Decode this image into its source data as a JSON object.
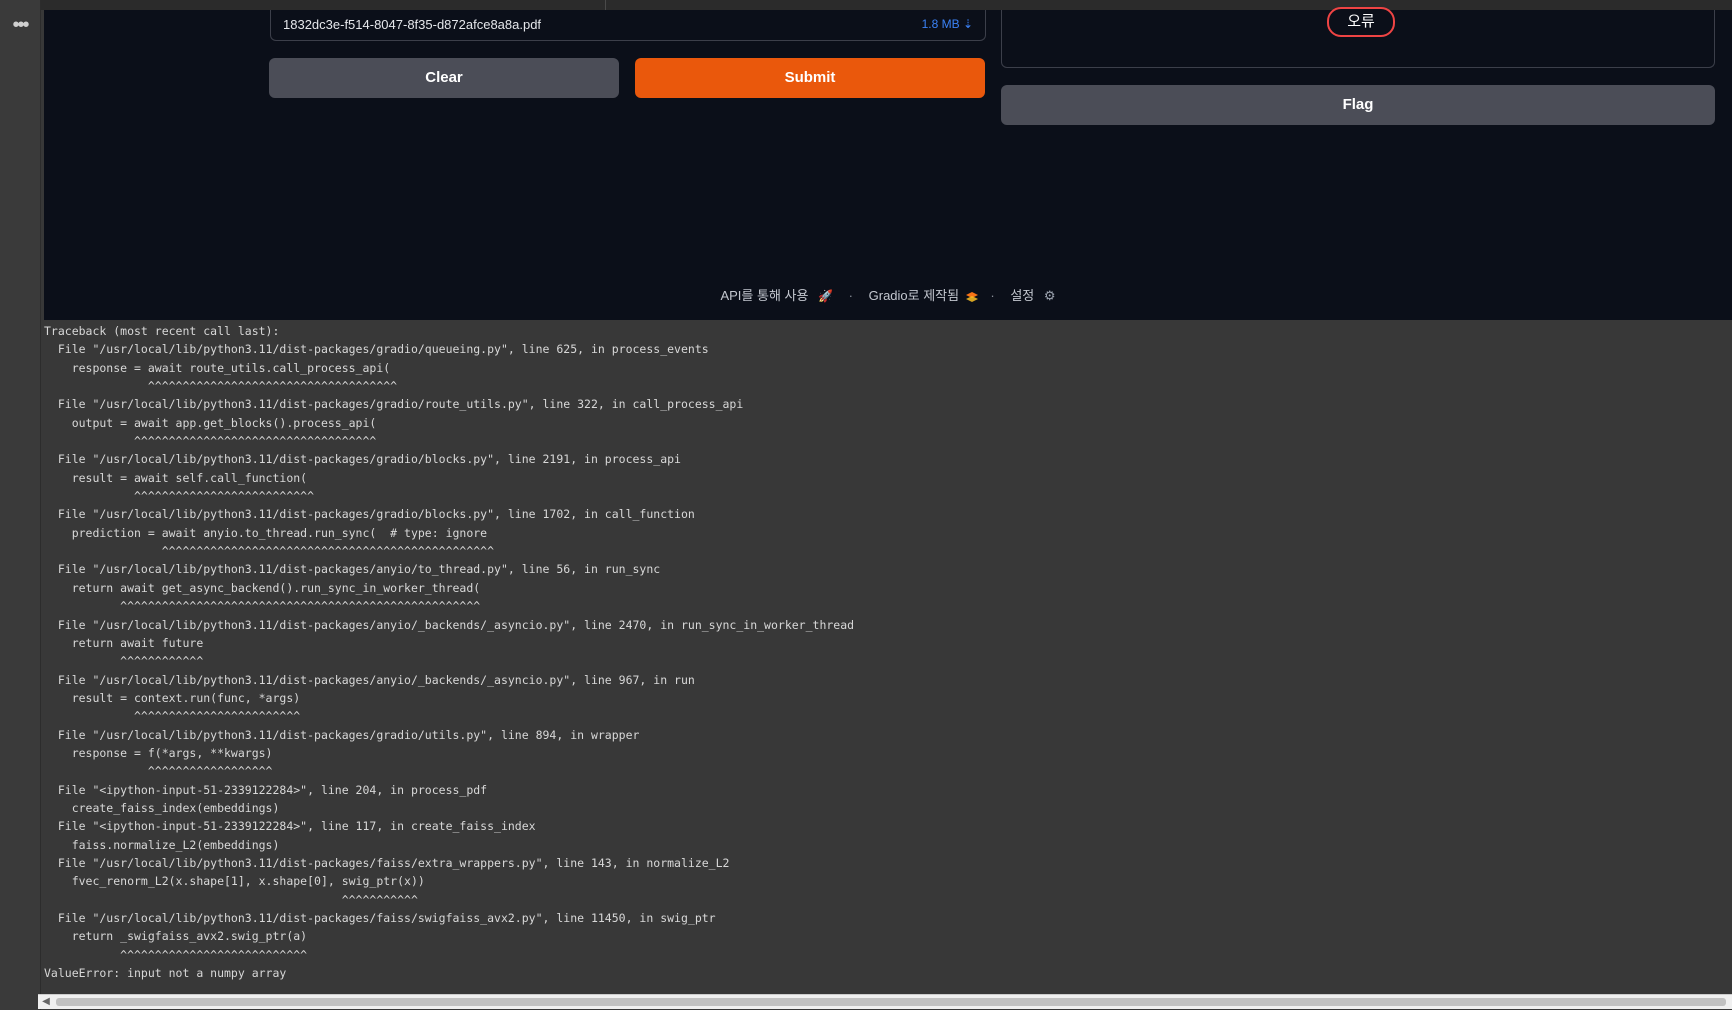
{
  "more_menu": {
    "label": "•••"
  },
  "input": {
    "file_name": "1832dc3e-f514-8047-8f35-d872afce8a8a.pdf",
    "file_size": "1.8 MB ⇣"
  },
  "buttons": {
    "clear": "Clear",
    "submit": "Submit",
    "flag": "Flag"
  },
  "output": {
    "status_badge": "오류"
  },
  "footer": {
    "api": "API를 통해 사용",
    "api_icon": "🚀",
    "gradio": "Gradio로 제작됨",
    "settings": "설정",
    "settings_icon": "⚙",
    "separator": "·"
  },
  "traceback": {
    "lines": [
      "Traceback (most recent call last):",
      "  File \"/usr/local/lib/python3.11/dist-packages/gradio/queueing.py\", line 625, in process_events",
      "    response = await route_utils.call_process_api(",
      "               ^^^^^^^^^^^^^^^^^^^^^^^^^^^^^^^^^^^^",
      "  File \"/usr/local/lib/python3.11/dist-packages/gradio/route_utils.py\", line 322, in call_process_api",
      "    output = await app.get_blocks().process_api(",
      "             ^^^^^^^^^^^^^^^^^^^^^^^^^^^^^^^^^^^",
      "  File \"/usr/local/lib/python3.11/dist-packages/gradio/blocks.py\", line 2191, in process_api",
      "    result = await self.call_function(",
      "             ^^^^^^^^^^^^^^^^^^^^^^^^^^",
      "  File \"/usr/local/lib/python3.11/dist-packages/gradio/blocks.py\", line 1702, in call_function",
      "    prediction = await anyio.to_thread.run_sync(  # type: ignore",
      "                 ^^^^^^^^^^^^^^^^^^^^^^^^^^^^^^^^^^^^^^^^^^^^^^^^",
      "  File \"/usr/local/lib/python3.11/dist-packages/anyio/to_thread.py\", line 56, in run_sync",
      "    return await get_async_backend().run_sync_in_worker_thread(",
      "           ^^^^^^^^^^^^^^^^^^^^^^^^^^^^^^^^^^^^^^^^^^^^^^^^^^^^",
      "  File \"/usr/local/lib/python3.11/dist-packages/anyio/_backends/_asyncio.py\", line 2470, in run_sync_in_worker_thread",
      "    return await future",
      "           ^^^^^^^^^^^^",
      "  File \"/usr/local/lib/python3.11/dist-packages/anyio/_backends/_asyncio.py\", line 967, in run",
      "    result = context.run(func, *args)",
      "             ^^^^^^^^^^^^^^^^^^^^^^^^",
      "  File \"/usr/local/lib/python3.11/dist-packages/gradio/utils.py\", line 894, in wrapper",
      "    response = f(*args, **kwargs)",
      "               ^^^^^^^^^^^^^^^^^^",
      "  File \"<ipython-input-51-2339122284>\", line 204, in process_pdf",
      "    create_faiss_index(embeddings)",
      "  File \"<ipython-input-51-2339122284>\", line 117, in create_faiss_index",
      "    faiss.normalize_L2(embeddings)",
      "  File \"/usr/local/lib/python3.11/dist-packages/faiss/extra_wrappers.py\", line 143, in normalize_L2",
      "    fvec_renorm_L2(x.shape[1], x.shape[0], swig_ptr(x))",
      "                                           ^^^^^^^^^^^",
      "  File \"/usr/local/lib/python3.11/dist-packages/faiss/swigfaiss_avx2.py\", line 11450, in swig_ptr",
      "    return _swigfaiss_avx2.swig_ptr(a)",
      "           ^^^^^^^^^^^^^^^^^^^^^^^^^^^",
      "ValueError: input not a numpy array"
    ]
  },
  "colors": {
    "app_background": "#0b0f19",
    "submit_accent": "#ea580c",
    "secondary_button": "#4b4d57",
    "error_border": "#ef4444",
    "file_size_link": "#3b82f6",
    "console_background": "#383838"
  },
  "scrollbar": {
    "left_arrow_icon": "◀"
  }
}
